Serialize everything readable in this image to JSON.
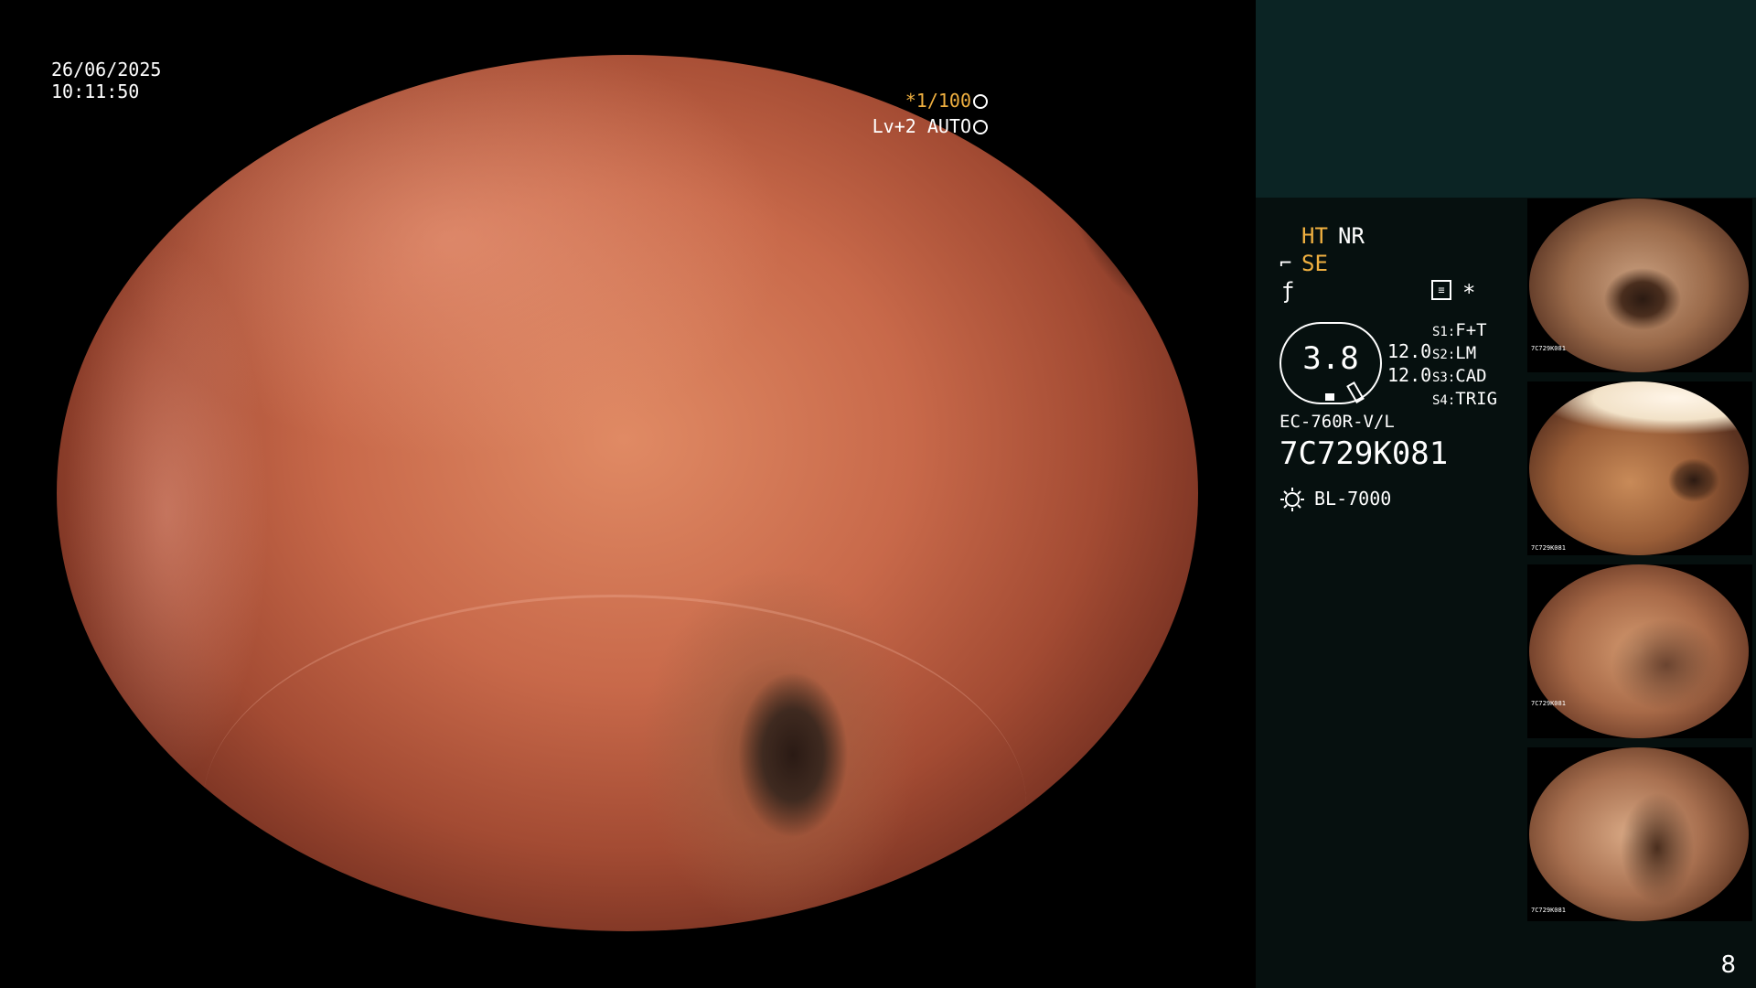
{
  "overlay": {
    "date": "26/06/2025",
    "time": "10:11:50",
    "shutter": "*1/100",
    "level": "Lv+2 AUTO"
  },
  "panel": {
    "ht_label": "HT",
    "nr_label": "NR",
    "se_label": "SE",
    "star": "*",
    "gauge_value": "3.8",
    "value1": "12.0",
    "value2": "12.0",
    "switches": [
      {
        "key": "S1:",
        "value": "F+T"
      },
      {
        "key": "S2:",
        "value": "LM"
      },
      {
        "key": "S3:",
        "value": "CAD"
      },
      {
        "key": "S4:",
        "value": "TRIG"
      }
    ],
    "scope_model": "EC-760R-V/L",
    "scope_serial": "7C729K081",
    "light_source": "BL-7000"
  },
  "thumbnails": [
    {
      "serial": "7C729K081"
    },
    {
      "serial": "7C729K081"
    },
    {
      "serial": "7C729K081"
    },
    {
      "serial": "7C729K081"
    }
  ],
  "page_number": "8",
  "colors": {
    "accent": "#f0b040",
    "panel_bg": "#06100f",
    "panel_top_bg": "#0b2424"
  },
  "icons": [
    "shutter-icon",
    "auto-exposure-icon",
    "enhancement-icon",
    "filter-icon",
    "mode-icon",
    "lamp-icon"
  ]
}
